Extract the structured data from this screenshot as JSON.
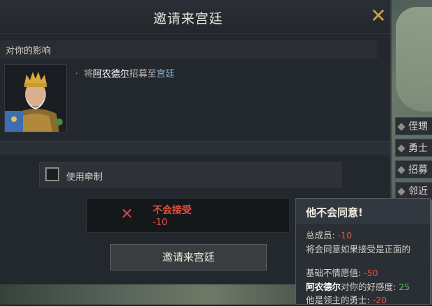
{
  "dialog": {
    "title": "邀请来宫廷",
    "close_icon": "close-icon",
    "section_header": "对你的影响",
    "effect": {
      "prefix": "将",
      "character": "阿农德尔",
      "mid": "招募至",
      "target": "宫廷"
    },
    "checkbox_label": "使用牵制",
    "result": {
      "title": "不会接受",
      "value": "-10"
    },
    "invite_button": "邀请来宫廷"
  },
  "side_panel": {
    "items": [
      {
        "label": "侄甥"
      },
      {
        "label": "勇士"
      },
      {
        "label": "招募"
      },
      {
        "label": "邻近"
      }
    ]
  },
  "tooltip": {
    "title": "他不会同意!",
    "total_label": "总成员:",
    "total_value": "-10",
    "note": "将会同意如果接受是正面的",
    "base_label": "基础不情愿值:",
    "base_value": "-50",
    "opinion_name": "阿农德尔",
    "opinion_label": "对你的好感度:",
    "opinion_value": "25",
    "champion_label": "他是领主的勇士:",
    "champion_value": "-20"
  },
  "colors": {
    "accent_gold": "#c9a14f",
    "negative": "#e5503f",
    "positive": "#5cb85c"
  }
}
